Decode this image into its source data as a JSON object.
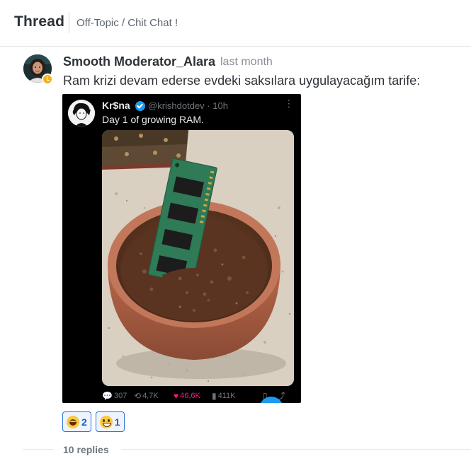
{
  "header": {
    "title": "Thread",
    "channel": "Off-Topic / Chit Chat !"
  },
  "message": {
    "author": "Smooth Moderator_Alara",
    "timestamp": "last month",
    "text": "Ram krizi devam ederse evdeki saksılara uygulayacağım tarife:",
    "status_color": "#f2b01e"
  },
  "tweet": {
    "name": "Kr$na",
    "handle": "@krishdotdev · 10h",
    "more": "⋮",
    "text": "Day 1 of growing RAM.",
    "stats": {
      "replies": "307",
      "retweets": "4,7K",
      "likes": "46,6K",
      "views": "411K"
    },
    "like_color": "#f91880",
    "accent_color": "#1d9bf0"
  },
  "reactions": [
    {
      "emoji": "laughing-emoji",
      "count": "2"
    },
    {
      "emoji": "grinning-emoji",
      "count": "1"
    }
  ],
  "replies": {
    "label": "10 replies"
  }
}
